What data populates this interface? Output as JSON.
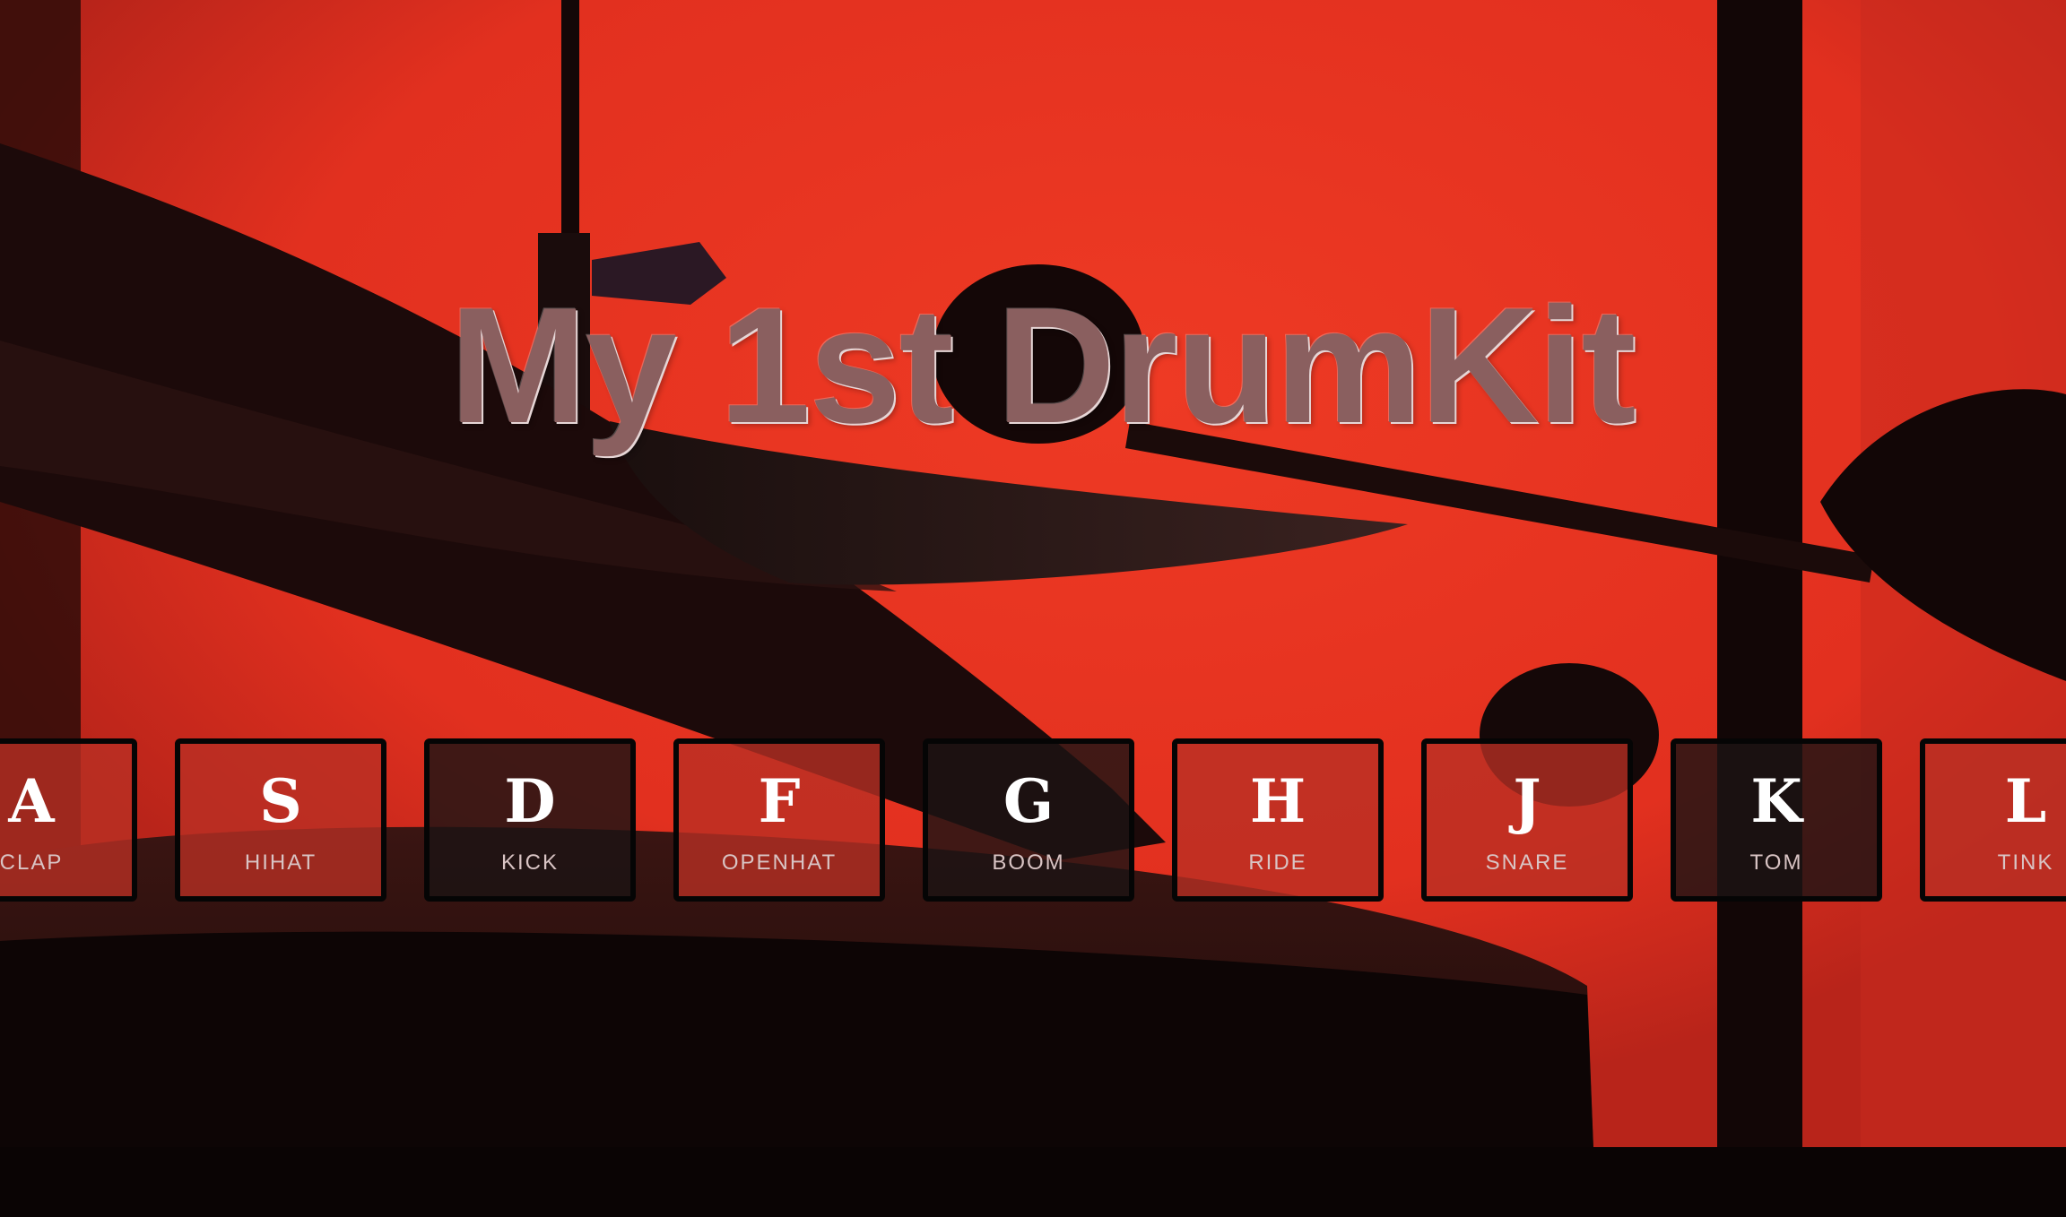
{
  "app": {
    "title": "My 1st DrumKit"
  },
  "keys": [
    {
      "letter": "A",
      "sound": "CLAP"
    },
    {
      "letter": "S",
      "sound": "HIHAT"
    },
    {
      "letter": "D",
      "sound": "KICK"
    },
    {
      "letter": "F",
      "sound": "OPENHAT"
    },
    {
      "letter": "G",
      "sound": "BOOM"
    },
    {
      "letter": "H",
      "sound": "RIDE"
    },
    {
      "letter": "J",
      "sound": "SNARE"
    },
    {
      "letter": "K",
      "sound": "TOM"
    },
    {
      "letter": "L",
      "sound": "TINK"
    }
  ],
  "colors": {
    "background_red": "#e83423",
    "title_fill": "#8a5f5f",
    "key_dark": "#1c1414",
    "key_red": "#b93024",
    "key_border": "#050505"
  }
}
